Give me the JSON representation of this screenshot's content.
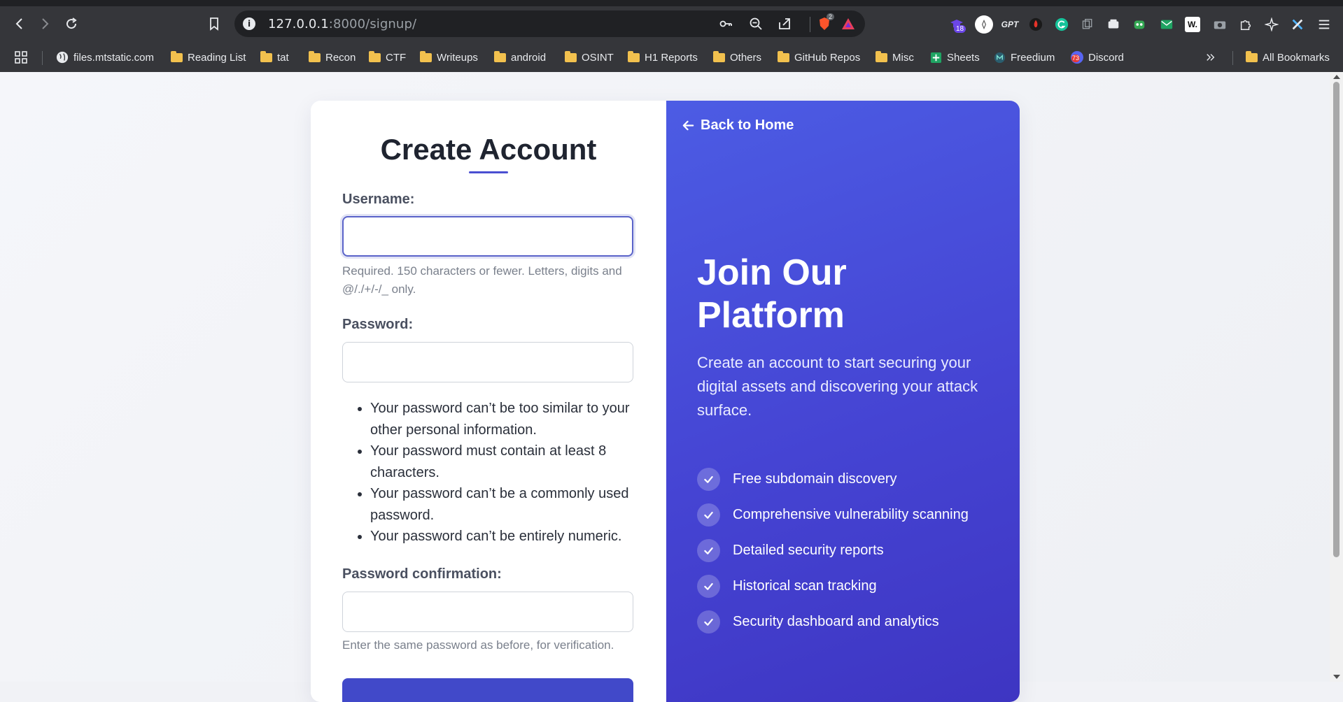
{
  "browser": {
    "url_host": "127.0.0.1",
    "url_path": ":8000/signup/",
    "brave_badge": "2",
    "ext_badge": "18",
    "ext_labels": {
      "gpt": "GPT",
      "w": "W."
    }
  },
  "bookmarks": [
    {
      "label": "files.mtstatic.com"
    },
    {
      "label": "Reading List"
    },
    {
      "label": "tat"
    },
    {
      "label": "Recon"
    },
    {
      "label": "CTF"
    },
    {
      "label": "Writeups"
    },
    {
      "label": "android"
    },
    {
      "label": "OSINT"
    },
    {
      "label": "H1 Reports"
    },
    {
      "label": "Others"
    },
    {
      "label": "GitHub Repos"
    },
    {
      "label": "Misc"
    },
    {
      "label": "Sheets"
    },
    {
      "label": "Freedium"
    },
    {
      "label": "Discord",
      "badge": "73"
    }
  ],
  "all_bookmarks": "All Bookmarks",
  "form": {
    "title": "Create Account",
    "username_label": "Username:",
    "username_value": "",
    "username_help": "Required. 150 characters or fewer. Letters, digits and @/./+/-/_ only.",
    "password_label": "Password:",
    "password_value": "",
    "password_rules": [
      "Your password can’t be too similar to your other personal information.",
      "Your password must contain at least 8 characters.",
      "Your password can’t be a commonly used password.",
      "Your password can’t be entirely numeric."
    ],
    "confirm_label": "Password confirmation:",
    "confirm_value": "",
    "confirm_help": "Enter the same password as before, for verification."
  },
  "promo": {
    "back_link": "Back to Home",
    "title": "Join Our Platform",
    "subtitle": "Create an account to start securing your digital assets and discovering your attack surface.",
    "features": [
      "Free subdomain discovery",
      "Comprehensive vulnerability scanning",
      "Detailed security reports",
      "Historical scan tracking",
      "Security dashboard and analytics"
    ]
  },
  "colors": {
    "accent": "#4a4fd1",
    "promo_gradient_start": "#4c5ce4",
    "promo_gradient_end": "#3e35c2",
    "chrome_bg": "#35363a"
  }
}
